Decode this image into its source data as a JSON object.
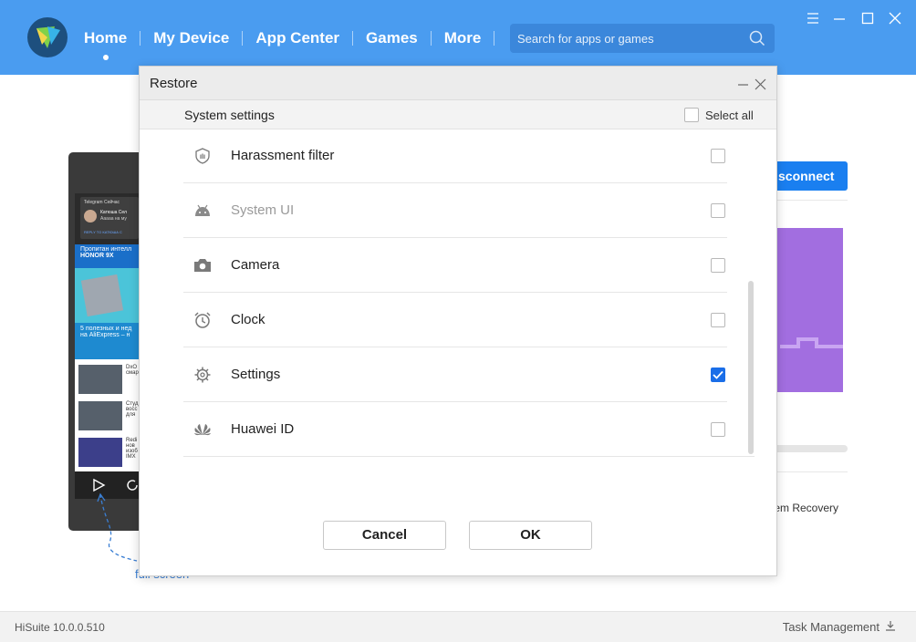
{
  "header": {
    "nav": [
      "Home",
      "My Device",
      "App Center",
      "Games",
      "More"
    ],
    "search_placeholder": "Search for apps or games",
    "accent": "#4a9cf0"
  },
  "background": {
    "connect_label": "sconnect",
    "recovery_label": "tem Recovery",
    "fullscreen_hint": "full screen",
    "phone_screen": {
      "notif_app": "Telegram  Сейчас",
      "notif_title": "Катюша Сел",
      "notif_body": "Ааааа на му",
      "notif_action": "REPLY TO КАТЮША С",
      "card1_line1": "Пропитан интелл",
      "card1_line2": "HONOR 9X",
      "card2_line1": "5 полезных и нед",
      "card2_line2": "на AliExpress – н",
      "item1": "DxO\nсмар",
      "item2": "Студ\nвосс\nдля",
      "item3": "Redi\nнов\nизоб\nIMX"
    }
  },
  "footer": {
    "version": "HiSuite 10.0.0.510",
    "task_management": "Task Management"
  },
  "modal": {
    "title": "Restore",
    "section": "System settings",
    "select_all": "Select all",
    "items": [
      {
        "label": "Harassment filter",
        "icon": "shield-hand-icon",
        "checked": false,
        "disabled": false
      },
      {
        "label": "System UI",
        "icon": "android-icon",
        "checked": false,
        "disabled": true
      },
      {
        "label": "Camera",
        "icon": "camera-icon",
        "checked": false,
        "disabled": false
      },
      {
        "label": "Clock",
        "icon": "alarm-clock-icon",
        "checked": false,
        "disabled": false
      },
      {
        "label": "Settings",
        "icon": "gear-icon",
        "checked": true,
        "disabled": false
      },
      {
        "label": "Huawei ID",
        "icon": "huawei-logo-icon",
        "checked": false,
        "disabled": false
      }
    ],
    "cancel_label": "Cancel",
    "ok_label": "OK",
    "checkbox_color": "#1a6ee8"
  }
}
